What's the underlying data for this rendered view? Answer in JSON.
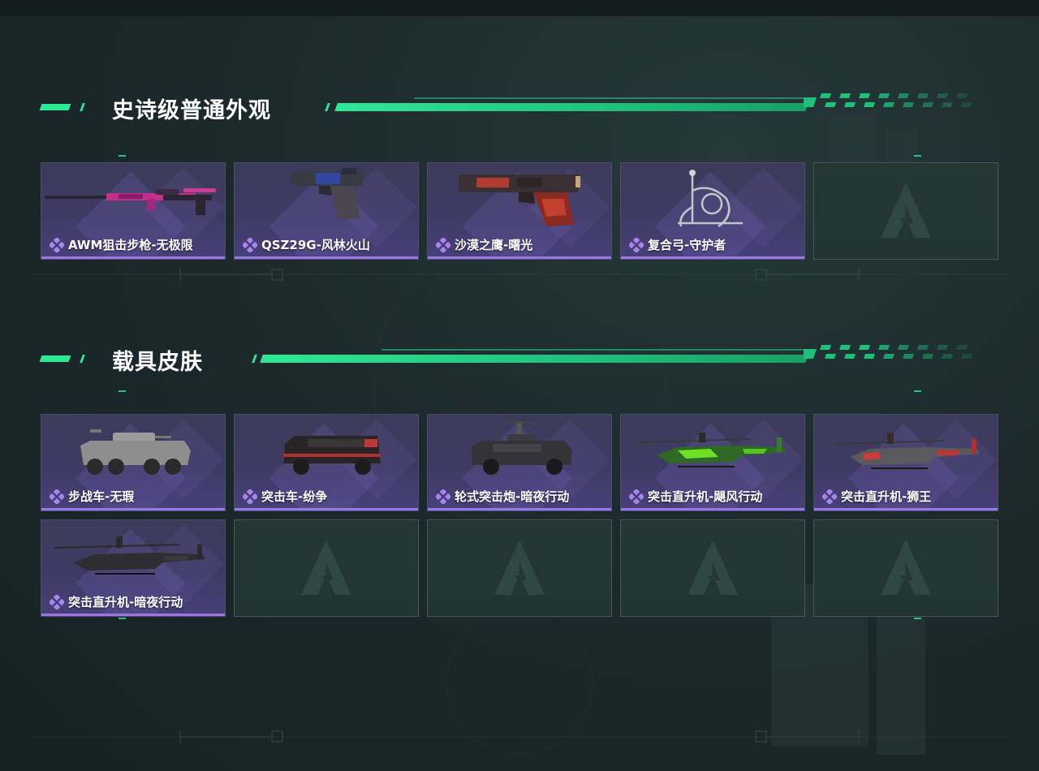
{
  "sections": [
    {
      "title": "史诗级普通外观",
      "items": [
        {
          "label": "AWM狙击步枪-无极限",
          "icon": "sniper-rifle-skin"
        },
        {
          "label": "QSZ29G-风林火山",
          "icon": "pistol-skin"
        },
        {
          "label": "沙漠之鹰-曙光",
          "icon": "desert-eagle-skin"
        },
        {
          "label": "复合弓-守护者",
          "icon": "compound-bow-skin"
        }
      ],
      "empty_slots": 1
    },
    {
      "title": "载具皮肤",
      "items": [
        {
          "label": "步战车-无瑕",
          "icon": "ifv-vehicle"
        },
        {
          "label": "突击车-纷争",
          "icon": "assault-truck"
        },
        {
          "label": "轮式突击炮-暗夜行动",
          "icon": "wheeled-assault-gun"
        },
        {
          "label": "突击直升机-飓风行动",
          "icon": "attack-helicopter-green"
        },
        {
          "label": "突击直升机-狮王",
          "icon": "attack-helicopter-red"
        },
        {
          "label": "突击直升机-暗夜行动",
          "icon": "attack-helicopter-dark"
        }
      ],
      "empty_slots": 4
    }
  ],
  "colors": {
    "accent": "#2ee896",
    "card_bg": "#3f3a64",
    "card_border_bottom": "#9b76e6",
    "empty_bg": "#243735",
    "page_bg": "#1c2a2d"
  }
}
